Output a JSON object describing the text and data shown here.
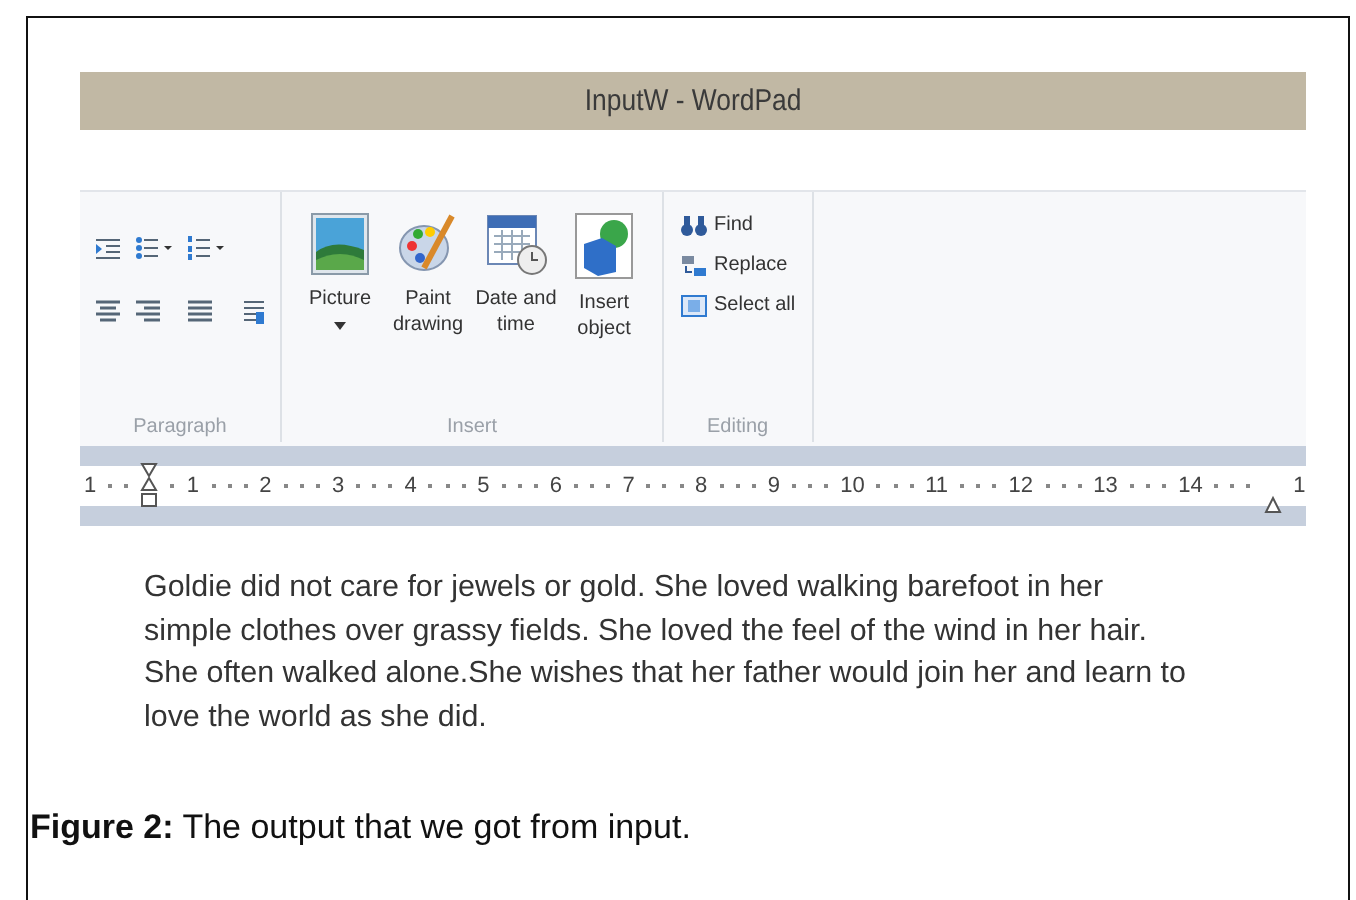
{
  "window": {
    "title": "InputW - WordPad"
  },
  "ribbon": {
    "groups": [
      {
        "label": "Paragraph",
        "kind": "paragraph"
      },
      {
        "label": "Insert",
        "kind": "large",
        "buttons": [
          {
            "label": "Picture",
            "dropdown": true
          },
          {
            "label": "Paint drawing",
            "dropdown": false
          },
          {
            "label": "Date and time",
            "dropdown": false
          },
          {
            "label": "Insert object",
            "dropdown": false
          }
        ]
      },
      {
        "label": "Editing",
        "kind": "small",
        "buttons": [
          {
            "label": "Find"
          },
          {
            "label": "Replace"
          },
          {
            "label": "Select all"
          }
        ]
      }
    ]
  },
  "ruler": {
    "numbers": [
      "1",
      "1",
      "2",
      "3",
      "4",
      "5",
      "6",
      "7",
      "8",
      "9",
      "10",
      "11",
      "12",
      "13",
      "14",
      "1"
    ]
  },
  "document": {
    "lines": [
      "Goldie did not care for jewels or gold. She loved walking barefoot in her",
      "simple clothes over grassy fields. She loved the feel of the wind in her hair.",
      "She often walked alone.She wishes that her father would join her and learn to",
      "love the world as she did."
    ]
  },
  "caption": "**Figure 2:** The output that we got from input."
}
